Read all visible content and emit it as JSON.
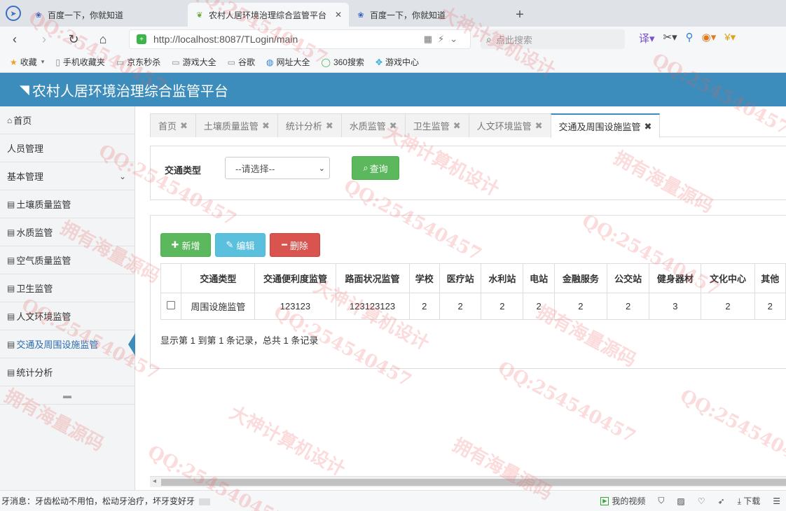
{
  "browser": {
    "tabs": [
      {
        "title": "百度一下，你就知道",
        "icon": "paw-icon",
        "active": false
      },
      {
        "title": "农村人居环境治理综合监管平台",
        "icon": "leaf-icon",
        "active": true
      },
      {
        "title": "百度一下，你就知道",
        "icon": "paw-icon",
        "active": false
      }
    ],
    "url": "http://localhost:8087/TLogin/main",
    "search_placeholder": "点此搜索",
    "bookmarks": [
      {
        "label": "收藏",
        "icon": "star-icon"
      },
      {
        "label": "手机收藏夹",
        "icon": "phone-icon"
      },
      {
        "label": "京东秒杀",
        "icon": "doc-icon"
      },
      {
        "label": "游戏大全",
        "icon": "doc-icon"
      },
      {
        "label": "谷歌",
        "icon": "doc-icon"
      },
      {
        "label": "网址大全",
        "icon": "web-icon"
      },
      {
        "label": "360搜索",
        "icon": "search360-icon"
      },
      {
        "label": "游戏中心",
        "icon": "game-icon"
      }
    ]
  },
  "app": {
    "title": "农村人居环境治理综合监管平台",
    "header_color": "#3c8dbc"
  },
  "sidebar": {
    "items": [
      {
        "label": "首页",
        "icon": "home-icon"
      },
      {
        "label": "人员管理",
        "icon": ""
      },
      {
        "label": "基本管理",
        "icon": "",
        "chevron": true
      },
      {
        "label": "土壤质量监管",
        "icon": "table-icon"
      },
      {
        "label": "水质监管",
        "icon": "table-icon"
      },
      {
        "label": "空气质量监管",
        "icon": "table-icon"
      },
      {
        "label": "卫生监管",
        "icon": "table-icon"
      },
      {
        "label": "人文环境监管",
        "icon": "table-icon"
      },
      {
        "label": "交通及周围设施监管",
        "icon": "table-icon",
        "active": true
      },
      {
        "label": "统计分析",
        "icon": "table-icon"
      }
    ]
  },
  "content_tabs": [
    {
      "label": "首页"
    },
    {
      "label": "土壤质量监管"
    },
    {
      "label": "统计分析"
    },
    {
      "label": "水质监管"
    },
    {
      "label": "卫生监管"
    },
    {
      "label": "人文环境监管"
    },
    {
      "label": "交通及周围设施监管",
      "active": true
    }
  ],
  "query": {
    "label": "交通类型",
    "select_value": "--请选择--",
    "button": "查询"
  },
  "toolbar": {
    "add": "新增",
    "edit": "编辑",
    "delete": "删除"
  },
  "table": {
    "columns": [
      "交通类型",
      "交通便利度监管",
      "路面状况监管",
      "学校",
      "医疗站",
      "水利站",
      "电站",
      "金融服务",
      "公交站",
      "健身器材",
      "文化中心",
      "其他"
    ],
    "rows": [
      [
        "周围设施监管",
        "123123",
        "123123123",
        "2",
        "2",
        "2",
        "2",
        "2",
        "2",
        "3",
        "2",
        "2"
      ]
    ]
  },
  "pager": "显示第 1 到第 1 条记录，总共 1 条记录",
  "statusbar": {
    "news": "牙消息：牙齿松动不用怕，松动牙治疗，坏牙变好牙",
    "video": "我的视频",
    "download": "下载"
  },
  "watermarks": [
    "QQ:254540457",
    "大神计算机设计",
    "拥有海量源码"
  ]
}
